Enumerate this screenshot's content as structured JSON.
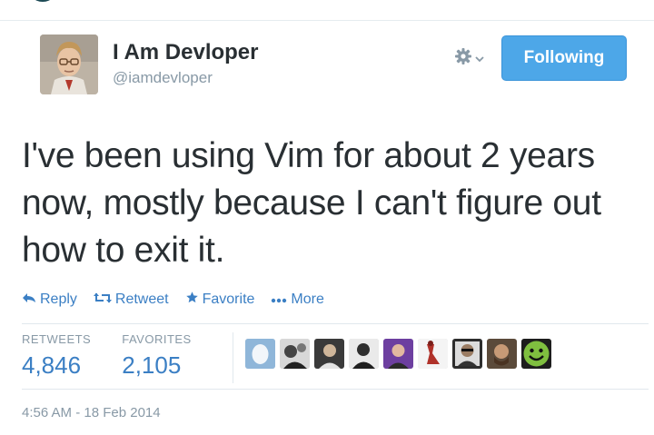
{
  "user": {
    "display_name": "I Am Devloper",
    "handle": "@iamdevloper"
  },
  "icons": {
    "gear": "gear-icon",
    "chevron": "chevron-down-icon",
    "reply": "reply-arrow-icon",
    "retweet": "retweet-arrows-icon",
    "favorite": "star-icon",
    "more": "ellipsis-icon"
  },
  "follow_button": {
    "label": "Following"
  },
  "tweet": {
    "text": "I've been using Vim for about 2 years now, mostly because I can't figure out how to exit it."
  },
  "actions": {
    "reply": "Reply",
    "retweet": "Retweet",
    "favorite": "Favorite",
    "more": "More"
  },
  "stats": {
    "retweets_label": "RETWEETS",
    "retweets_value": "4,846",
    "favorites_label": "FAVORITES",
    "favorites_value": "2,105"
  },
  "timestamp": "4:56 AM - 18 Feb 2014",
  "colors": {
    "link_blue": "#3b7fc4",
    "button_blue": "#4da7e8",
    "text": "#292f33",
    "muted": "#8899a6"
  }
}
